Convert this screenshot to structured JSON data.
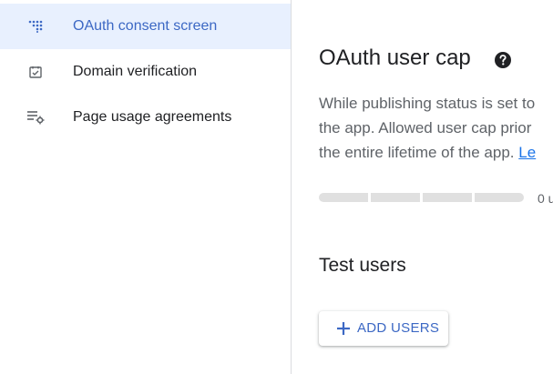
{
  "sidebar": {
    "items": [
      {
        "label": "OAuth consent screen",
        "icon": "oauth-consent-icon",
        "active": true
      },
      {
        "label": "Domain verification",
        "icon": "domain-check-icon",
        "active": false
      },
      {
        "label": "Page usage agreements",
        "icon": "page-usage-settings-icon",
        "active": false
      }
    ]
  },
  "main": {
    "title": "OAuth user cap",
    "help_icon": "help-icon",
    "description": {
      "line1": "While publishing status is set to",
      "line2": "the app. Allowed user cap prior",
      "line3_text": "the entire lifetime of the app.",
      "line3_link": "Le"
    },
    "progress": {
      "value": 0,
      "label": "0 u"
    },
    "test_users_title": "Test users",
    "add_users_button": "ADD USERS"
  },
  "colors": {
    "accent": "#3c68c4",
    "active_bg": "#e8f0fe",
    "link": "#1a73e8",
    "progress_track": "#e0e0e0"
  }
}
